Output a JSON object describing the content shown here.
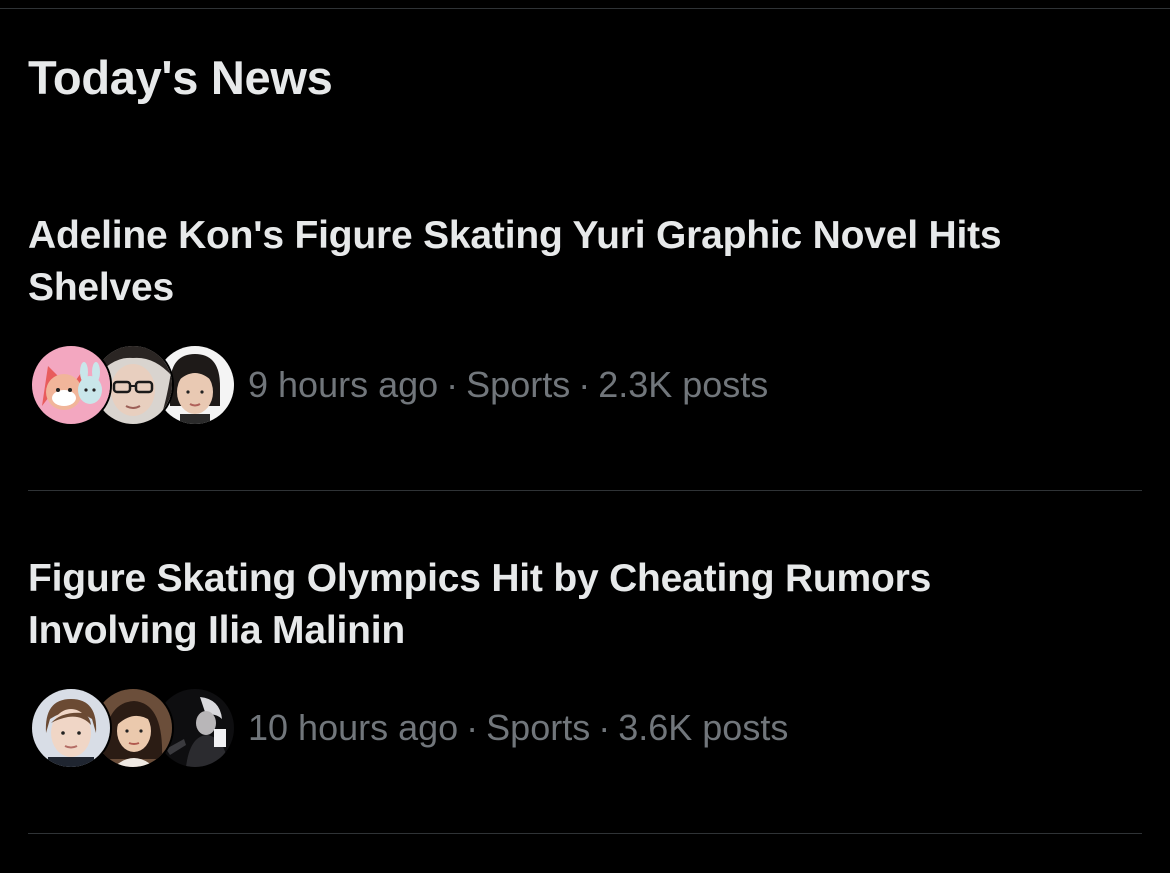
{
  "section": {
    "title": "Today's News"
  },
  "items": [
    {
      "headline": "Adeline Kon's Figure Skating Yuri Graphic Novel Hits Shelves",
      "time": "9 hours ago",
      "category": "Sports",
      "posts": "2.3K posts",
      "avatars": [
        "illustrated-fox-bunny-avatar",
        "person-glasses-avatar",
        "person-portrait-avatar"
      ]
    },
    {
      "headline": "Figure Skating Olympics Hit by Cheating Rumors Involving Ilia Malinin",
      "time": "10 hours ago",
      "category": "Sports",
      "posts": "3.6K posts",
      "avatars": [
        "person-portrait-avatar",
        "person-portrait-avatar",
        "dark-photo-avatar"
      ]
    }
  ],
  "colors": {
    "background": "#000000",
    "primary_text": "#e7e9ea",
    "secondary_text": "#71767b",
    "divider": "#2f3336"
  }
}
